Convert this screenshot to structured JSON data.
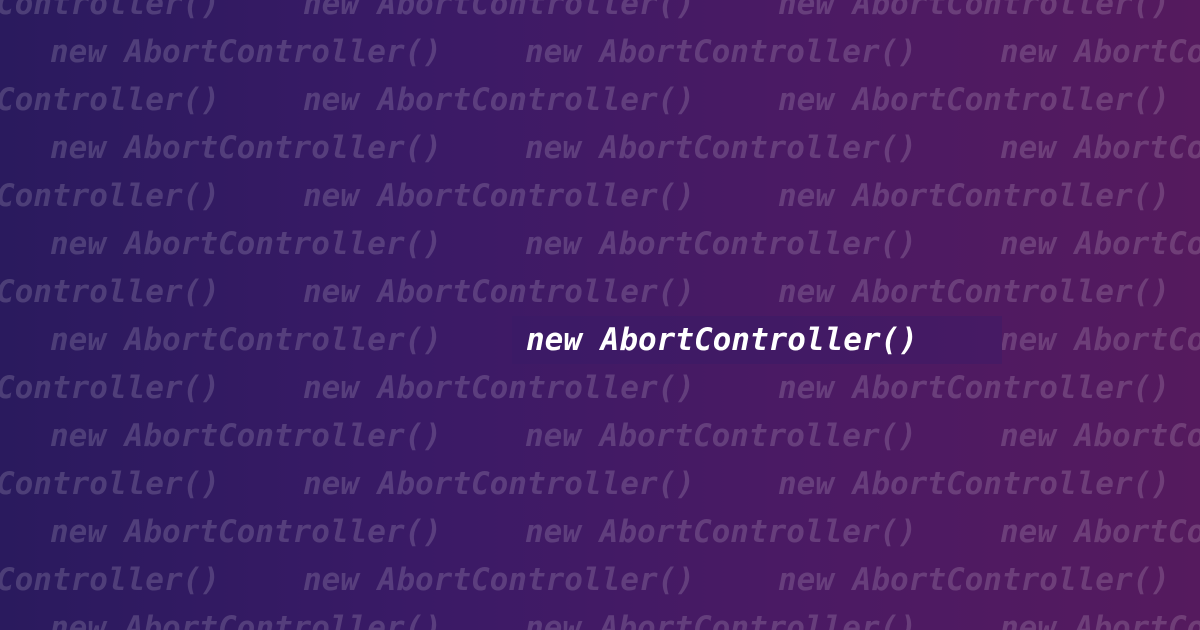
{
  "pattern": {
    "repeat_text": "new AbortController()",
    "text_color": "rgba(255,255,255,0.16)"
  },
  "headline": {
    "text": "new AbortController()",
    "color": "#ffffff"
  },
  "background": {
    "gradient_start": "#2a1a5e",
    "gradient_end": "#551a5e"
  }
}
